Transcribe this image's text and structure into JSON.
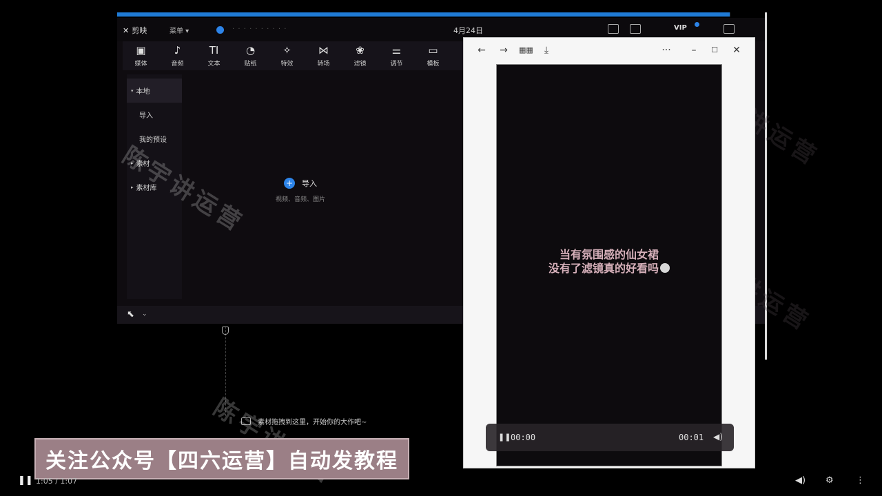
{
  "outer_player": {
    "progress_fraction": 0.999,
    "elapsed_time": "1:05 / 1:07",
    "accent_color": "#1f7bd6"
  },
  "editor": {
    "app_name": "剪映",
    "menu_label": "菜单 ▾",
    "project_title": "· · · · · · · · · ·",
    "date_title": "4月24日",
    "vip_label": "VIP",
    "toolbar": [
      {
        "icon": "media-icon",
        "glyph": "▣",
        "label": "媒体"
      },
      {
        "icon": "audio-icon",
        "glyph": "♪",
        "label": "音频"
      },
      {
        "icon": "text-icon",
        "glyph": "TI",
        "label": "文本"
      },
      {
        "icon": "sticker-icon",
        "glyph": "◔",
        "label": "贴纸"
      },
      {
        "icon": "effects-icon",
        "glyph": "✧",
        "label": "特效"
      },
      {
        "icon": "transition-icon",
        "glyph": "⋈",
        "label": "转场"
      },
      {
        "icon": "filter-icon",
        "glyph": "❀",
        "label": "滤镜"
      },
      {
        "icon": "adjust-icon",
        "glyph": "⚌",
        "label": "调节"
      },
      {
        "icon": "template-icon",
        "glyph": "▭",
        "label": "模板"
      }
    ],
    "sidebar": {
      "local": "本地",
      "import": "导入",
      "my_presets": "我的预设",
      "materials": "素材",
      "library": "素材库"
    },
    "import_area": {
      "label": "导入",
      "hint": "视频、音频、图片"
    },
    "timeline_hint": "素材拖拽到这里，开始你的大作吧~"
  },
  "preview_popup": {
    "caption_line1": "当有氛围感的仙女裙",
    "caption_line2": "没有了滤镜真的好看吗",
    "current_time": "00:00",
    "duration": "00:01"
  },
  "banner": {
    "text": "关注公众号【四六运营】自动发教程",
    "color": "#9b7f86"
  },
  "watermark": {
    "text": "陈宇讲运营"
  }
}
